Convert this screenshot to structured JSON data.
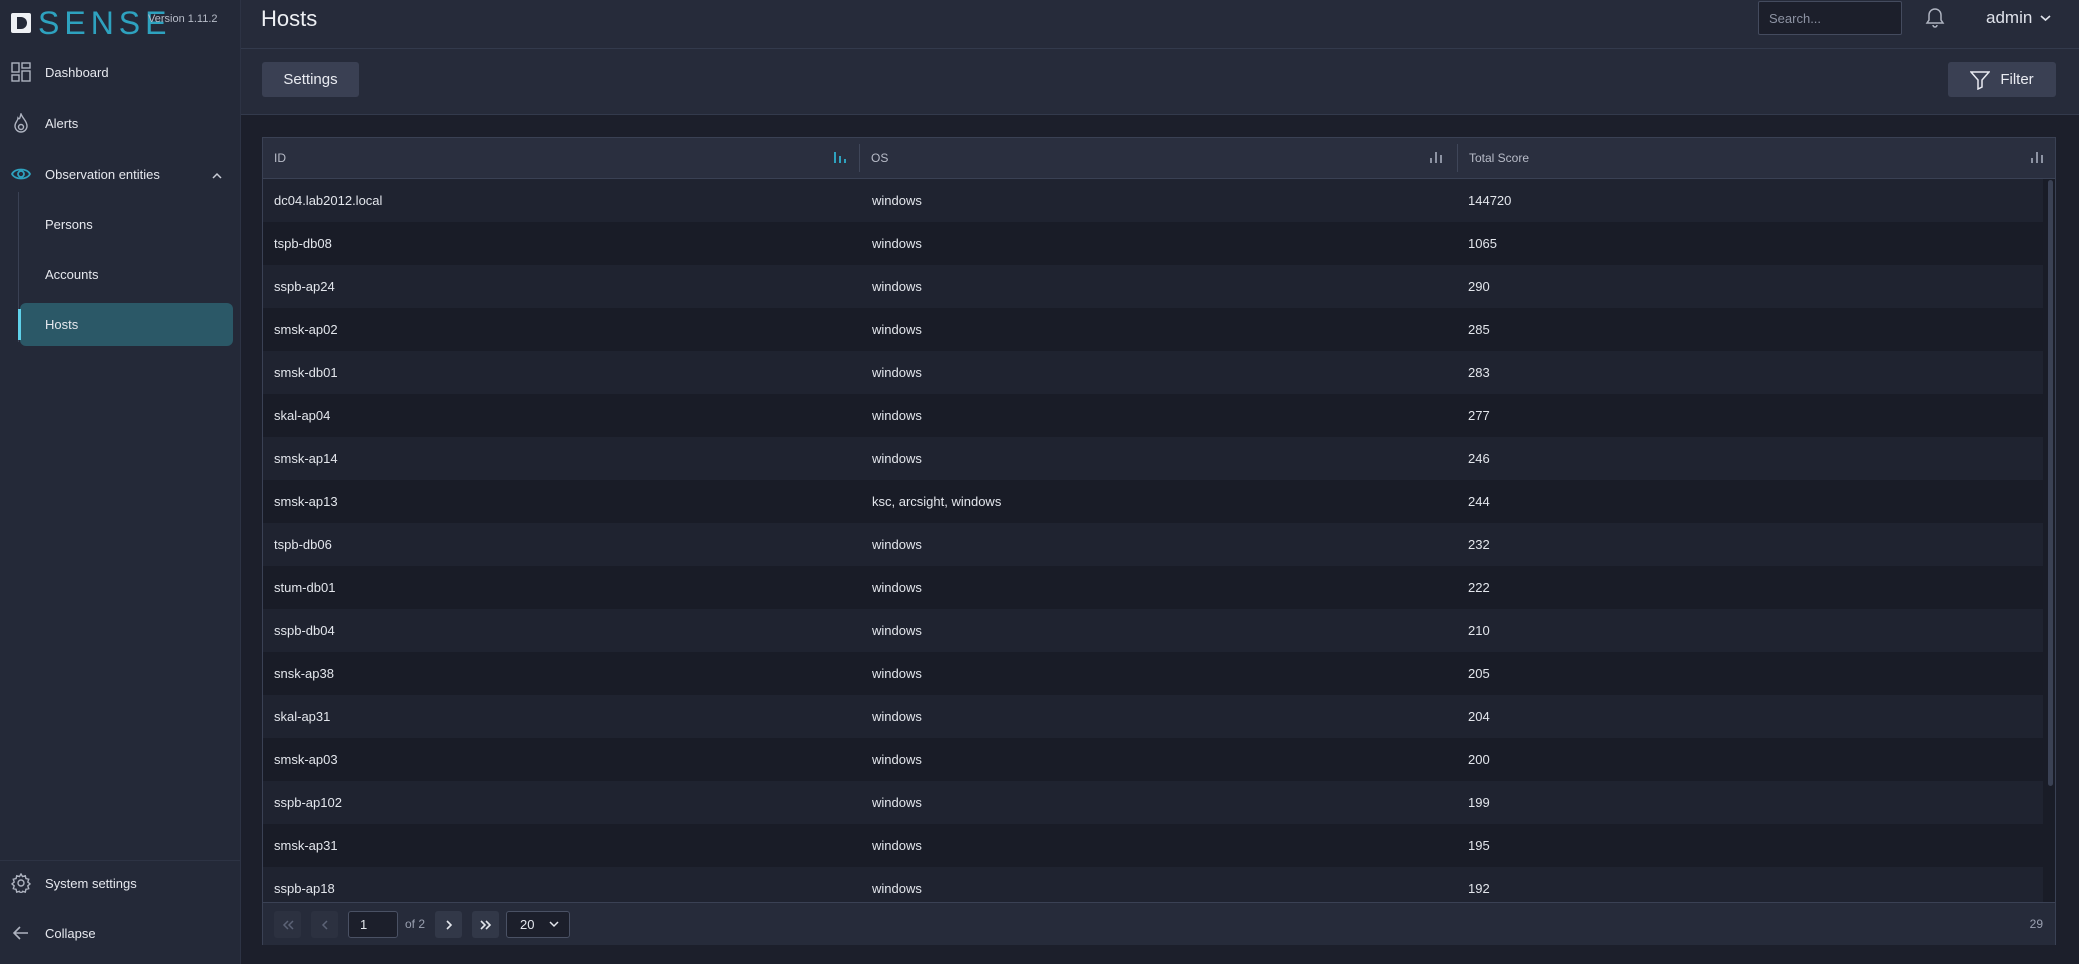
{
  "brand": {
    "name": "SENSE",
    "version": "Version 1.11.2"
  },
  "sidebar": {
    "items": [
      {
        "label": "Dashboard"
      },
      {
        "label": "Alerts"
      },
      {
        "label": "Observation entities"
      }
    ],
    "subitems": [
      {
        "label": "Persons"
      },
      {
        "label": "Accounts"
      },
      {
        "label": "Hosts"
      }
    ],
    "bottom": [
      {
        "label": "System settings"
      },
      {
        "label": "Collapse"
      }
    ]
  },
  "header": {
    "title": "Hosts",
    "search_placeholder": "Search...",
    "user": "admin"
  },
  "toolbar": {
    "settings_label": "Settings",
    "filter_label": "Filter"
  },
  "table": {
    "columns": [
      "ID",
      "OS",
      "Total Score"
    ],
    "rows": [
      [
        "dc04.lab2012.local",
        "windows",
        "144720"
      ],
      [
        "tspb-db08",
        "windows",
        "1065"
      ],
      [
        "sspb-ap24",
        "windows",
        "290"
      ],
      [
        "smsk-ap02",
        "windows",
        "285"
      ],
      [
        "smsk-db01",
        "windows",
        "283"
      ],
      [
        "skal-ap04",
        "windows",
        "277"
      ],
      [
        "smsk-ap14",
        "windows",
        "246"
      ],
      [
        "smsk-ap13",
        "ksc, arcsight, windows",
        "244"
      ],
      [
        "tspb-db06",
        "windows",
        "232"
      ],
      [
        "stum-db01",
        "windows",
        "222"
      ],
      [
        "sspb-db04",
        "windows",
        "210"
      ],
      [
        "snsk-ap38",
        "windows",
        "205"
      ],
      [
        "skal-ap31",
        "windows",
        "204"
      ],
      [
        "smsk-ap03",
        "windows",
        "200"
      ],
      [
        "sspb-ap102",
        "windows",
        "199"
      ],
      [
        "smsk-ap31",
        "windows",
        "195"
      ],
      [
        "sspb-ap18",
        "windows",
        "192"
      ]
    ]
  },
  "pagination": {
    "page": "1",
    "of_label": "of 2",
    "page_size": "20",
    "total": "29"
  },
  "colors": {
    "accent": "#2ea2bf",
    "active_bg": "#2b5867",
    "active_bar": "#5fd1ea"
  }
}
